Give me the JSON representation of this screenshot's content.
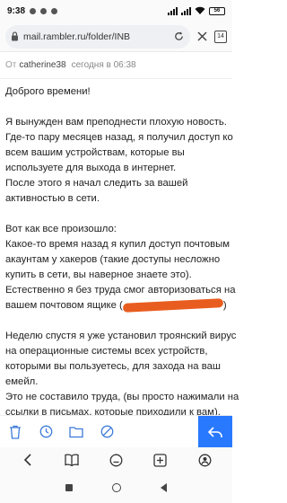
{
  "status_bar": {
    "time": "9:38",
    "battery": "56"
  },
  "browser": {
    "url": "mail.rambler.ru/folder/INB",
    "tab_count": "14"
  },
  "mail": {
    "from_label": "От",
    "sender": "catherine38",
    "date": "сегодня в 06:38",
    "body": {
      "greeting": "Доброго времени!",
      "para1": [
        "Я вынужден вам преподнести плохую новость.",
        "Где-то пару месяцев назад, я получил доступ ко",
        "всем вашим устройствам, которые вы",
        "используете для выхода в интернет.",
        "После этого я начал следить за вашей",
        "активностью в сети."
      ],
      "para2": [
        "Вот как все произошло:",
        "Какое-то время назад я купил доступ почтовым",
        "акаунтам у хакеров (такие доступы несложно",
        "купить в сети, вы наверное знаете это).",
        "Естественно я без труда смог авторизоваться на"
      ],
      "para2_last_prefix": "вашем почтовом ящике (",
      "para2_last_suffix": ")",
      "para3": [
        "Неделю спустя я уже установил троянский вирус",
        "на операционные системы всех устройств,",
        "которыми вы пользуетесь, для захода на ваш",
        "емейл.",
        "Это не составило труда, (вы просто нажимали на",
        "ссылки в письмах, которые приходили к вам)."
      ]
    }
  },
  "colors": {
    "accent": "#2979ff",
    "redaction": "#e85d1f"
  },
  "icons": {
    "toolbar": [
      "trash-icon",
      "clock-icon",
      "folder-icon",
      "spam-icon",
      "reply-icon"
    ],
    "browser_nav": [
      "back-icon",
      "bookmarks-icon",
      "home-icon",
      "add-tab-icon",
      "profile-icon"
    ]
  }
}
